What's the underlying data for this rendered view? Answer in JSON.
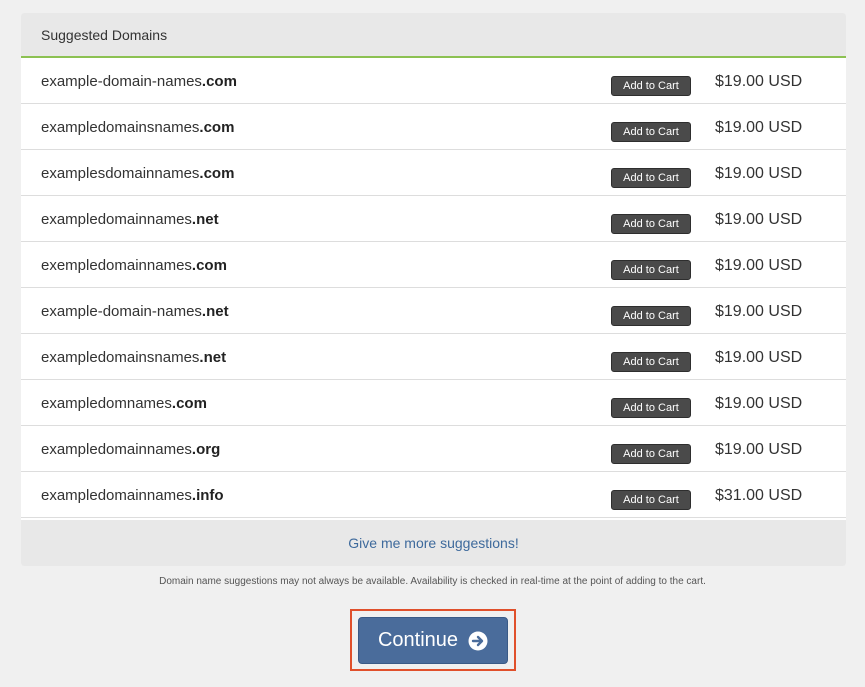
{
  "panel": {
    "title": "Suggested Domains"
  },
  "suggestions": [
    {
      "name": "example-domain-names",
      "tld": ".com",
      "button": "Add to Cart",
      "price": "$19.00 USD"
    },
    {
      "name": "exampledomainsnames",
      "tld": ".com",
      "button": "Add to Cart",
      "price": "$19.00 USD"
    },
    {
      "name": "examplesdomainnames",
      "tld": ".com",
      "button": "Add to Cart",
      "price": "$19.00 USD"
    },
    {
      "name": "exampledomainnames",
      "tld": ".net",
      "button": "Add to Cart",
      "price": "$19.00 USD"
    },
    {
      "name": "exempledomainnames",
      "tld": ".com",
      "button": "Add to Cart",
      "price": "$19.00 USD"
    },
    {
      "name": "example-domain-names",
      "tld": ".net",
      "button": "Add to Cart",
      "price": "$19.00 USD"
    },
    {
      "name": "exampledomainsnames",
      "tld": ".net",
      "button": "Add to Cart",
      "price": "$19.00 USD"
    },
    {
      "name": "exampledomnames",
      "tld": ".com",
      "button": "Add to Cart",
      "price": "$19.00 USD"
    },
    {
      "name": "exampledomainnames",
      "tld": ".org",
      "button": "Add to Cart",
      "price": "$19.00 USD"
    },
    {
      "name": "exampledomainnames",
      "tld": ".info",
      "button": "Add to Cart",
      "price": "$31.00 USD"
    }
  ],
  "more_link": "Give me more suggestions!",
  "note": "Domain name suggestions may not always be available. Availability is checked in real-time at the point of adding to the cart.",
  "continue": {
    "label": "Continue",
    "icon": "arrow-circle-right-icon"
  },
  "colors": {
    "accent_green": "#8cc152",
    "button_blue": "#4a6c9b",
    "link_blue": "#3e6a9c",
    "highlight_outline": "#e0502b"
  }
}
